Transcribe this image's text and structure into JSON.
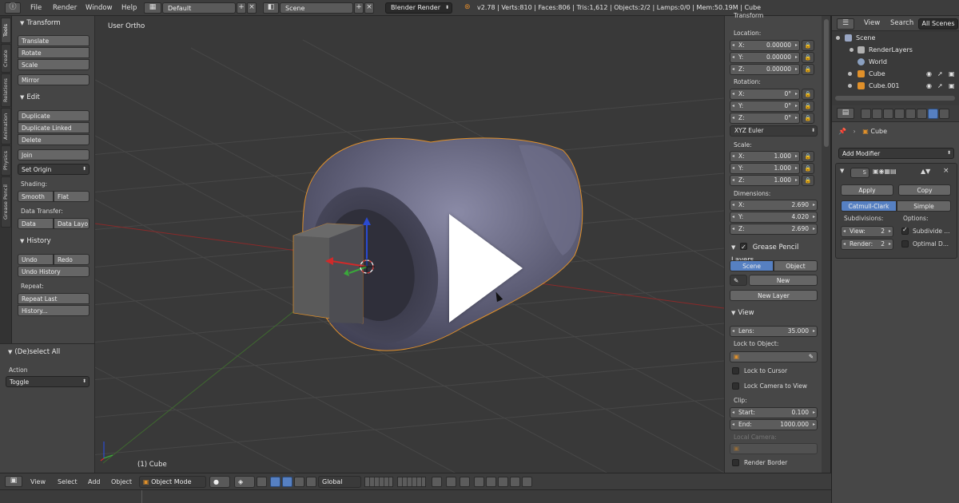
{
  "top_menu": {
    "items": [
      "File",
      "Render",
      "Window",
      "Help"
    ],
    "screen_layout": "Default",
    "scene": "Scene",
    "render_engine": "Blender Render",
    "stats": "v2.78 | Verts:810 | Faces:806 | Tris:1,612 | Objects:2/2 | Lamps:0/0 | Mem:50.19M | Cube"
  },
  "tool_tabs": [
    "Tools",
    "Create",
    "Relations",
    "Animation",
    "Physics",
    "Grease Pencil"
  ],
  "tool_shelf": {
    "transform": {
      "title": "Transform",
      "translate": "Translate",
      "rotate": "Rotate",
      "scale": "Scale",
      "mirror": "Mirror"
    },
    "edit": {
      "title": "Edit",
      "duplicate": "Duplicate",
      "duplicate_linked": "Duplicate Linked",
      "delete": "Delete",
      "join": "Join",
      "set_origin": "Set Origin",
      "shading_label": "Shading:",
      "smooth": "Smooth",
      "flat": "Flat",
      "data_transfer_label": "Data Transfer:",
      "data": "Data",
      "data_layout": "Data Layo"
    },
    "history": {
      "title": "History",
      "undo": "Undo",
      "redo": "Redo",
      "undo_history": "Undo History",
      "repeat_label": "Repeat:",
      "repeat_last": "Repeat Last",
      "history_btn": "History..."
    }
  },
  "operator_panel": {
    "title": "(De)select All",
    "action_label": "Action",
    "action_value": "Toggle"
  },
  "viewport": {
    "view_name": "User Ortho",
    "active_object": "(1) Cube"
  },
  "properties_n": {
    "transform_title": "Transform",
    "location_label": "Location:",
    "location": [
      {
        "axis": "X:",
        "value": "0.00000"
      },
      {
        "axis": "Y:",
        "value": "0.00000"
      },
      {
        "axis": "Z:",
        "value": "0.00000"
      }
    ],
    "rotation_label": "Rotation:",
    "rotation": [
      {
        "axis": "X:",
        "value": "0°"
      },
      {
        "axis": "Y:",
        "value": "0°"
      },
      {
        "axis": "Z:",
        "value": "0°"
      }
    ],
    "rotation_mode": "XYZ Euler",
    "scale_label": "Scale:",
    "scale": [
      {
        "axis": "X:",
        "value": "1.000"
      },
      {
        "axis": "Y:",
        "value": "1.000"
      },
      {
        "axis": "Z:",
        "value": "1.000"
      }
    ],
    "dimensions_label": "Dimensions:",
    "dimensions": [
      {
        "axis": "X:",
        "value": "2.690"
      },
      {
        "axis": "Y:",
        "value": "4.020"
      },
      {
        "axis": "Z:",
        "value": "2.690"
      }
    ],
    "grease_pencil": {
      "title": "Grease Pencil Layers",
      "scene": "Scene",
      "object": "Object",
      "new": "New",
      "new_layer": "New Layer"
    },
    "view": {
      "title": "View",
      "lens_label": "Lens:",
      "lens_value": "35.000",
      "lock_to_object": "Lock to Object:",
      "lock_to_cursor": "Lock to Cursor",
      "lock_camera": "Lock Camera to View",
      "clip_label": "Clip:",
      "clip_start_label": "Start:",
      "clip_start": "0.100",
      "clip_end_label": "End:",
      "clip_end": "1000.000",
      "local_camera": "Local Camera:",
      "render_border": "Render Border"
    }
  },
  "outliner": {
    "view": "View",
    "search": "Search",
    "filter": "All Scenes",
    "items": [
      {
        "label": "Scene",
        "icon_color": "#9aa7c4"
      },
      {
        "label": "RenderLayers",
        "icon_color": "#b0b0b0"
      },
      {
        "label": "World",
        "icon_color": "#8aa0c0"
      },
      {
        "label": "Cube",
        "icon_color": "#e0902a"
      },
      {
        "label": "Cube.001",
        "icon_color": "#e0902a"
      }
    ]
  },
  "modifier_panel": {
    "breadcrumb_object": "Cube",
    "add_modifier": "Add Modifier",
    "modifier_short": "S",
    "apply": "Apply",
    "copy": "Copy",
    "catmull_clark": "Catmull-Clark",
    "simple": "Simple",
    "subdivisions_label": "Subdivisions:",
    "options_label": "Options:",
    "view_label": "View:",
    "view_value": "2",
    "render_label": "Render:",
    "render_value": "2",
    "subdivide_uvs": "Subdivide ...",
    "optimal_display": "Optimal D..."
  },
  "bottom_bar": {
    "view": "View",
    "select": "Select",
    "add": "Add",
    "object": "Object",
    "mode": "Object Mode",
    "orientation": "Global"
  },
  "colors": {
    "accent_blue": "#5680c2",
    "object_orange": "#e0902a",
    "x_axis": "#d02a2a",
    "y_axis": "#3aa83a",
    "z_axis": "#2a4ad0"
  }
}
